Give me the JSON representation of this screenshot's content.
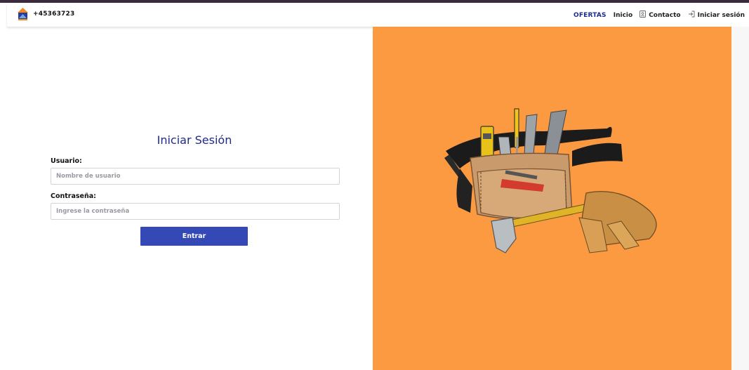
{
  "header": {
    "phone": "+45363723",
    "nav": {
      "offers": "OFERTAS",
      "home": "Inicio",
      "contact": "Contacto",
      "login": "Iniciar sesión"
    }
  },
  "login": {
    "title": "Iniciar Sesión",
    "username_label": "Usuario:",
    "username_placeholder": "Nombre de usuario",
    "username_value": "",
    "password_label": "Contraseña:",
    "password_placeholder": "Ingrese la contraseña",
    "password_value": "",
    "submit_label": "Entrar"
  },
  "colors": {
    "brand_blue": "#1f2a8c",
    "button_blue": "#3449b5",
    "hero_orange": "#fb9a40"
  },
  "hero": {
    "image": "tool-belt-with-tools-illustration"
  }
}
